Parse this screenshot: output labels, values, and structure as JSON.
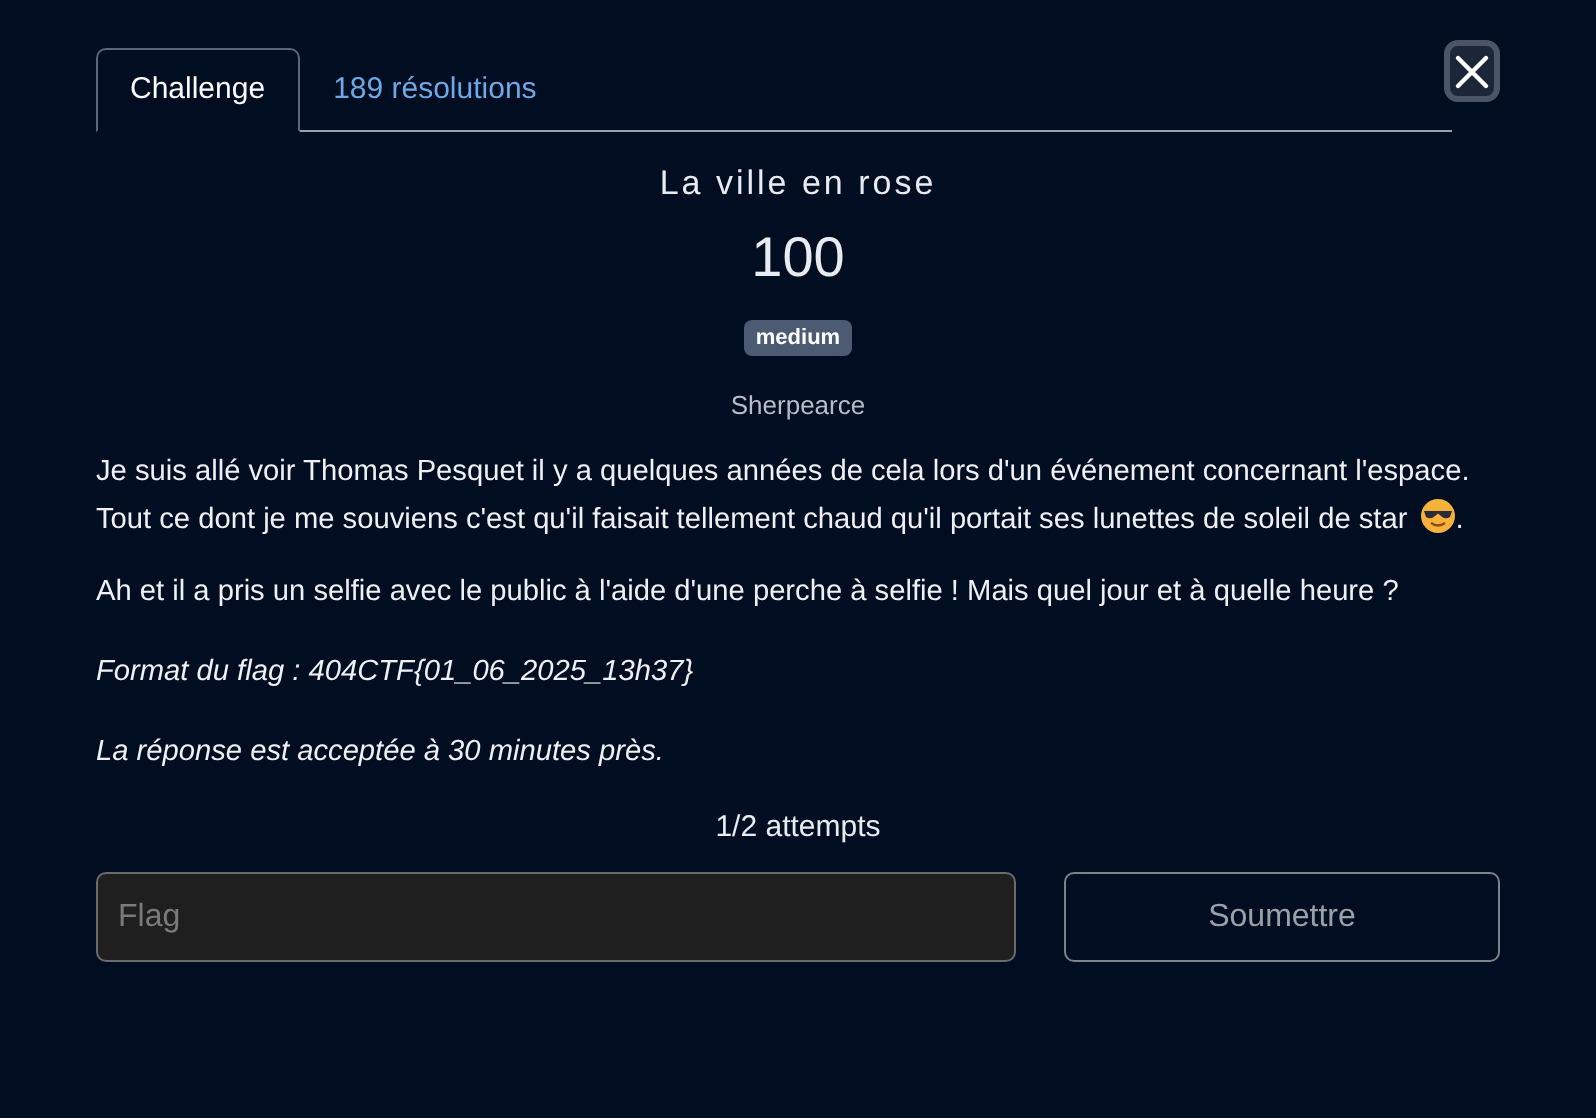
{
  "tabs": [
    {
      "label": "Challenge",
      "selected": true
    },
    {
      "label": "189 résolutions",
      "selected": false
    }
  ],
  "challenge": {
    "title": "La ville en rose",
    "points": "100",
    "difficulty": "medium",
    "author": "Sherpearce"
  },
  "description": [
    {
      "kind": "emoji",
      "text": "Je suis allé voir Thomas Pesquet il y a quelques années de cela lors d'un événement concernant l'espace. Tout ce dont je me souviens c'est qu'il faisait tellement chaud qu'il portait ses lunettes de soleil de star",
      "after": "."
    },
    {
      "kind": "plain",
      "text": "Ah et il a pris un selfie avec le public à l'aide d'une perche à selfie ! Mais quel jour et à quelle heure ?"
    },
    {
      "kind": "italic",
      "text": "Format du flag : 404CTF{01_06_2025_13h37}"
    },
    {
      "kind": "italic",
      "text": "La réponse est acceptée à 30 minutes près."
    }
  ],
  "attempts": "1/2 attempts",
  "flag_field": {
    "placeholder": "Flag"
  },
  "submit_button": "Soumettre"
}
